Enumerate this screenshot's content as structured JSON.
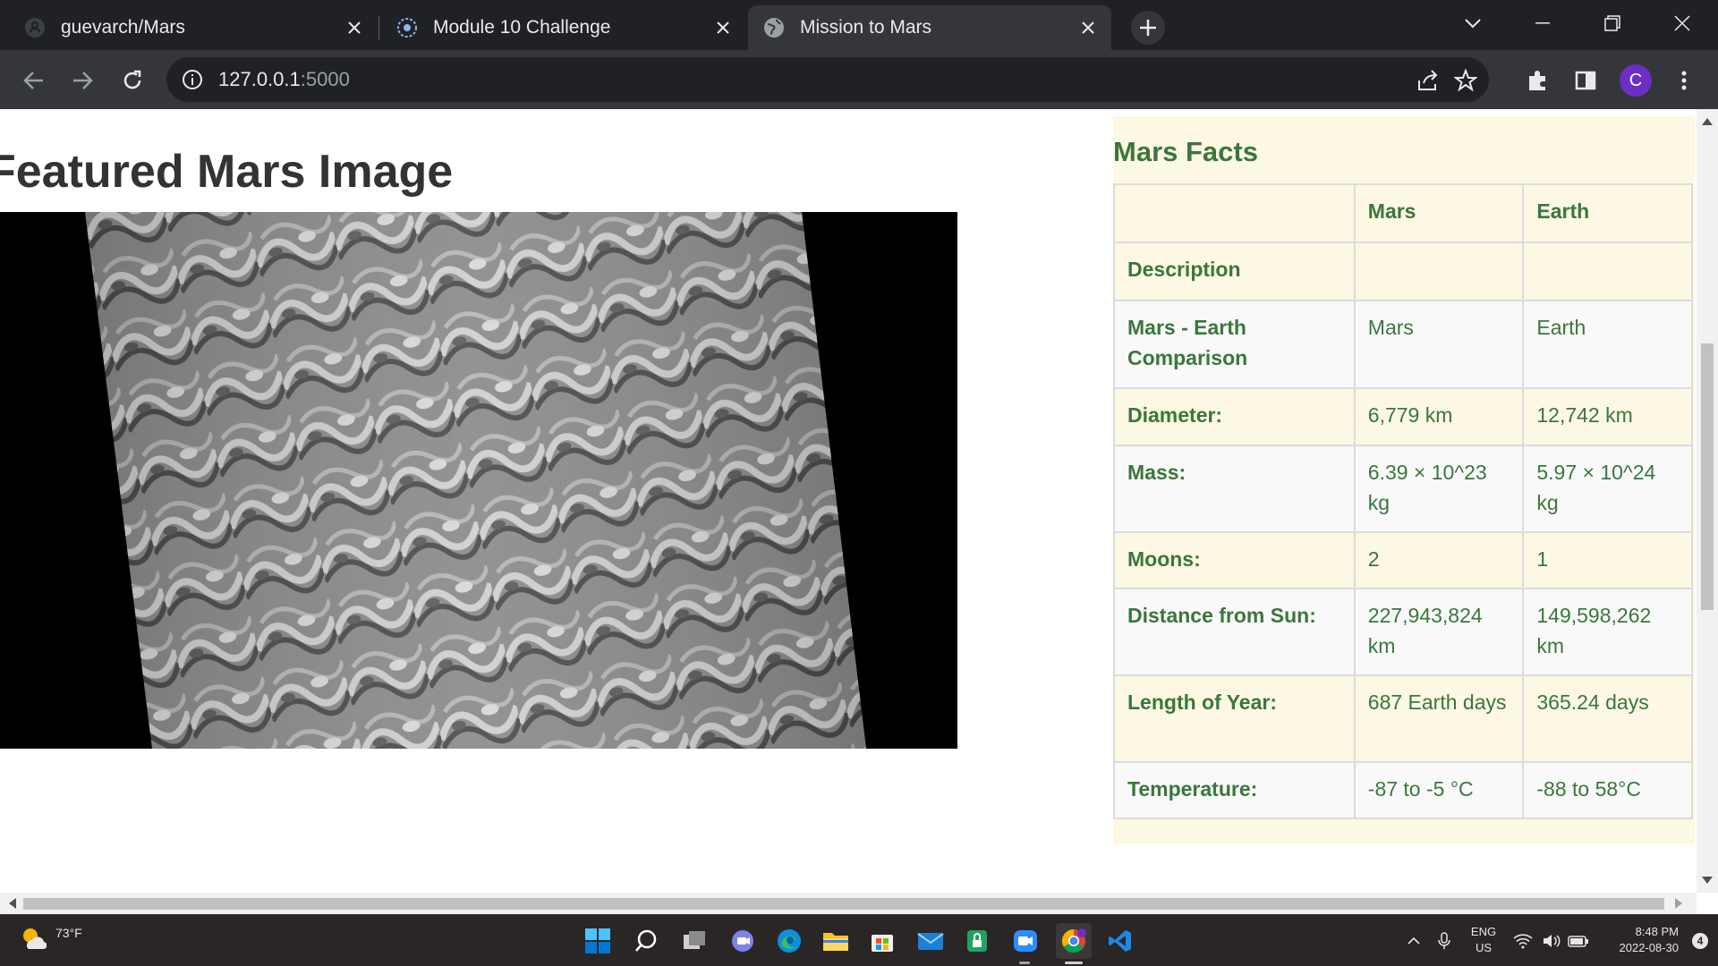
{
  "browser": {
    "tabs": [
      {
        "title": "guevarch/Mars",
        "icon": "github-icon",
        "active": false
      },
      {
        "title": "Module 10 Challenge",
        "icon": "module-icon",
        "active": false
      },
      {
        "title": "Mission to Mars",
        "icon": "globe-icon",
        "active": true
      }
    ],
    "url_host": "127.0.0.1",
    "url_port": ":5000",
    "avatar_letter": "C"
  },
  "page": {
    "featured_title": "Featured Mars Image",
    "facts": {
      "title": "Mars Facts",
      "columns": [
        "",
        "Mars",
        "Earth"
      ],
      "rows": [
        {
          "label": "Description",
          "mars": "",
          "earth": ""
        },
        {
          "label": "Mars - Earth Comparison",
          "mars": "Mars",
          "earth": "Earth"
        },
        {
          "label": "Diameter:",
          "mars": "6,779 km",
          "earth": "12,742 km"
        },
        {
          "label": "Mass:",
          "mars": "6.39 × 10^23 kg",
          "earth": "5.97 × 10^24 kg"
        },
        {
          "label": "Moons:",
          "mars": "2",
          "earth": "1"
        },
        {
          "label": "Distance from Sun:",
          "mars": "227,943,824 km",
          "earth": "149,598,262 km"
        },
        {
          "label": "Length of Year:",
          "mars": "687 Earth days",
          "earth": "365.24 days"
        },
        {
          "label": "Temperature:",
          "mars": "-87 to -5 °C",
          "earth": "-88 to 58°C"
        }
      ]
    }
  },
  "taskbar": {
    "weather": "73°F",
    "lang_top": "ENG",
    "lang_bottom": "US",
    "time": "8:48 PM",
    "date": "2022-08-30",
    "notifications": "4"
  },
  "colors": {
    "facts_text": "#3c763d",
    "facts_bg": "#fcf8e3",
    "chrome_dark": "#202124",
    "chrome_toolbar": "#35363a"
  }
}
